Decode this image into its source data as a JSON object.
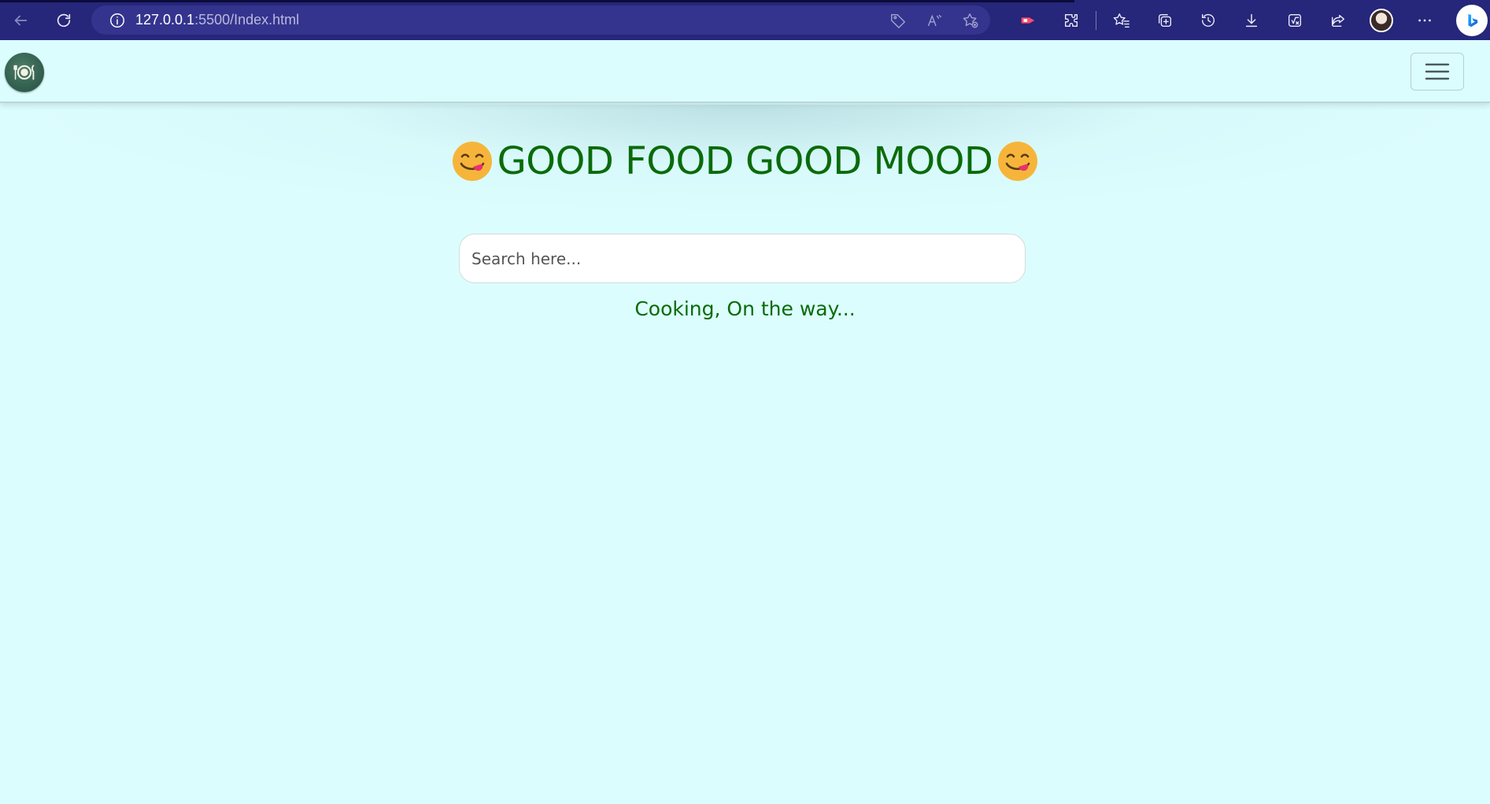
{
  "browser": {
    "url_host": "127.0.0.1",
    "url_path": ":5500/Index.html"
  },
  "icons": {
    "back": "back-arrow-icon",
    "refresh": "refresh-icon",
    "site_info": "info-icon",
    "tag": "tag-icon",
    "read_aloud": "read-aloud-icon",
    "add_favorite": "add-favorite-icon",
    "extension_red": "extension-icon",
    "extensions": "puzzle-icon",
    "favorites": "favorites-icon",
    "collections": "collections-icon",
    "history": "history-icon",
    "downloads": "download-icon",
    "math_solver": "math-solver-icon",
    "share": "share-icon",
    "profile": "avatar",
    "more": "more-icon",
    "bing": "bing-icon",
    "brand": "plate-cutlery-icon",
    "menu": "hamburger-icon",
    "emoji": "yum-face-emoji"
  },
  "page": {
    "heading": "GOOD FOOD GOOD MOOD",
    "search_placeholder": "Search here...",
    "status": "Cooking, On the way..."
  },
  "colors": {
    "browser_bar": "#26267a",
    "page_background": "#dcfdfe",
    "heading_green": "#0a6b0a",
    "logo_green": "#2f5b4b"
  }
}
